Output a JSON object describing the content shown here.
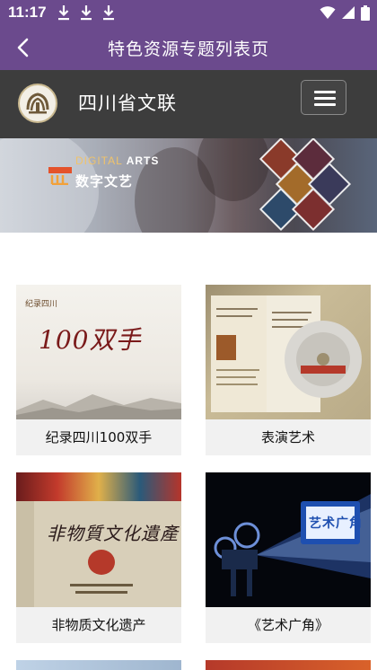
{
  "status_bar": {
    "time": "11:17",
    "icons": [
      "download-icon",
      "download-icon",
      "download-icon",
      "wifi-icon",
      "signal-icon",
      "battery-icon"
    ]
  },
  "title_bar": {
    "title": "特色资源专题列表页",
    "back_icon": "back-arrow-icon",
    "background": "#6b4a8d"
  },
  "site_header": {
    "name": "四川省文联",
    "menu_icon": "hamburger-menu-icon",
    "background": "#3d3d3d"
  },
  "banner": {
    "brand_en_prefix": "DIGITAL",
    "brand_en_suffix": "ARTS",
    "brand_cn": "数字文艺"
  },
  "cards": [
    {
      "label": "纪录四川100双手",
      "image_text": "纪录四川100双手"
    },
    {
      "label": "表演艺术",
      "image_text": "表演艺术"
    },
    {
      "label": "非物质文化遗产",
      "image_text": "非物质文化遗产"
    },
    {
      "label": "《艺术广角》",
      "image_text": "艺术广角"
    }
  ]
}
